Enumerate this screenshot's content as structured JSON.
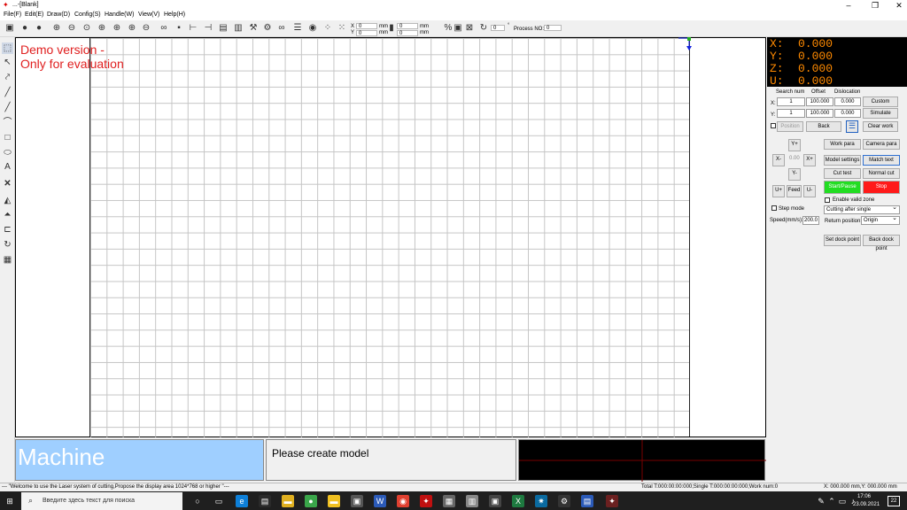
{
  "window": {
    "title": "...-[Blank]"
  },
  "menu": [
    "File(F)",
    "Edit(E)",
    "Draw(D)",
    "Config(S)",
    "Handle(W)",
    "View(V)",
    "Help(H)"
  ],
  "toolbar": {
    "x_label": "X",
    "y_label": "Y",
    "x_value": "0",
    "y_value": "0",
    "unit_mm": "mm",
    "w_value": "0",
    "h_value": "0",
    "w_unit": "mm",
    "h_unit": "mm",
    "rotate_value": "0",
    "degree": "°",
    "process_label": "Process NO:",
    "process_value": "0"
  },
  "demo": {
    "line1": "Demo version -",
    "line2": "Only for evaluation"
  },
  "coords": {
    "x_label": "X:",
    "x_value": "0.000",
    "y_label": "Y:",
    "y_value": "0.000",
    "z_label": "Z:",
    "z_value": "0.000",
    "u_label": "U:",
    "u_value": "0.000"
  },
  "panel": {
    "search_num": "Search num",
    "offset": "Offset",
    "dislocation": "Dislocation",
    "x_label": "X:",
    "y_label": "Y:",
    "x_search": "1",
    "x_offset": "100.000",
    "x_disloc": "0.000",
    "y_search": "1",
    "y_offset": "100.000",
    "y_disloc": "0.000",
    "custom": "Custom",
    "simulate": "Simulate",
    "position": "Position",
    "back": "Back",
    "clear_work": "Clear work",
    "y_plus": "Y+",
    "x_minus": "X-",
    "x_plus": "X+",
    "y_minus": "Y-",
    "jog_value": "0.00",
    "u_plus": "U+",
    "feed": "Feed",
    "u_minus": "U-",
    "work_para": "Work para",
    "camera_para": "Camera para",
    "model_settings": "Model settings",
    "match_text": "Match text",
    "cut_test": "Cut test",
    "normal_cut": "Normal cut",
    "start_pause": "Start/Pause",
    "stop": "Stop",
    "enable_valid_zone": "Enable valid zone",
    "step_mode": "Step mode",
    "cutting_after": "Cutting after single",
    "speed_label": "Speed(mm/s):",
    "speed_value": "200.0",
    "return_label": "Return position:",
    "return_value": "Origin",
    "set_dock": "Set dock point",
    "back_dock": "Back dock point"
  },
  "bottom": {
    "machine": "Machine",
    "message": "Please create model"
  },
  "status": {
    "left": "--- \"Welcome to use the Laser system of cutting,Propose the display area 1024*768 or higher \"---",
    "middle": "Total T:000:00:00:000;Single T:000:00:00:000;Work num:0",
    "right": "X: 000.000 mm,Y: 000.000 mm"
  },
  "taskbar": {
    "search_placeholder": "Введите здесь текст для поиска",
    "time": "17:06",
    "date": "23.09.2021",
    "notif": "22"
  },
  "colors": {
    "start": "#22dd22",
    "stop": "#ff1a1a",
    "coords_text": "#ff8a00",
    "machine_bg": "#9fcfff"
  }
}
